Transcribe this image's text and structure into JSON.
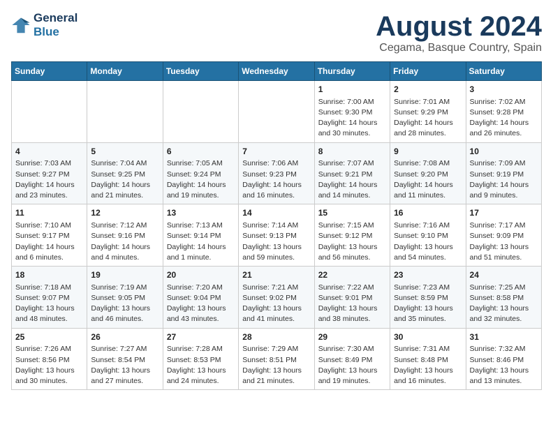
{
  "logo": {
    "line1": "General",
    "line2": "Blue"
  },
  "title": "August 2024",
  "location": "Cegama, Basque Country, Spain",
  "headers": [
    "Sunday",
    "Monday",
    "Tuesday",
    "Wednesday",
    "Thursday",
    "Friday",
    "Saturday"
  ],
  "weeks": [
    [
      {
        "day": "",
        "info": ""
      },
      {
        "day": "",
        "info": ""
      },
      {
        "day": "",
        "info": ""
      },
      {
        "day": "",
        "info": ""
      },
      {
        "day": "1",
        "info": "Sunrise: 7:00 AM\nSunset: 9:30 PM\nDaylight: 14 hours\nand 30 minutes."
      },
      {
        "day": "2",
        "info": "Sunrise: 7:01 AM\nSunset: 9:29 PM\nDaylight: 14 hours\nand 28 minutes."
      },
      {
        "day": "3",
        "info": "Sunrise: 7:02 AM\nSunset: 9:28 PM\nDaylight: 14 hours\nand 26 minutes."
      }
    ],
    [
      {
        "day": "4",
        "info": "Sunrise: 7:03 AM\nSunset: 9:27 PM\nDaylight: 14 hours\nand 23 minutes."
      },
      {
        "day": "5",
        "info": "Sunrise: 7:04 AM\nSunset: 9:25 PM\nDaylight: 14 hours\nand 21 minutes."
      },
      {
        "day": "6",
        "info": "Sunrise: 7:05 AM\nSunset: 9:24 PM\nDaylight: 14 hours\nand 19 minutes."
      },
      {
        "day": "7",
        "info": "Sunrise: 7:06 AM\nSunset: 9:23 PM\nDaylight: 14 hours\nand 16 minutes."
      },
      {
        "day": "8",
        "info": "Sunrise: 7:07 AM\nSunset: 9:21 PM\nDaylight: 14 hours\nand 14 minutes."
      },
      {
        "day": "9",
        "info": "Sunrise: 7:08 AM\nSunset: 9:20 PM\nDaylight: 14 hours\nand 11 minutes."
      },
      {
        "day": "10",
        "info": "Sunrise: 7:09 AM\nSunset: 9:19 PM\nDaylight: 14 hours\nand 9 minutes."
      }
    ],
    [
      {
        "day": "11",
        "info": "Sunrise: 7:10 AM\nSunset: 9:17 PM\nDaylight: 14 hours\nand 6 minutes."
      },
      {
        "day": "12",
        "info": "Sunrise: 7:12 AM\nSunset: 9:16 PM\nDaylight: 14 hours\nand 4 minutes."
      },
      {
        "day": "13",
        "info": "Sunrise: 7:13 AM\nSunset: 9:14 PM\nDaylight: 14 hours\nand 1 minute."
      },
      {
        "day": "14",
        "info": "Sunrise: 7:14 AM\nSunset: 9:13 PM\nDaylight: 13 hours\nand 59 minutes."
      },
      {
        "day": "15",
        "info": "Sunrise: 7:15 AM\nSunset: 9:12 PM\nDaylight: 13 hours\nand 56 minutes."
      },
      {
        "day": "16",
        "info": "Sunrise: 7:16 AM\nSunset: 9:10 PM\nDaylight: 13 hours\nand 54 minutes."
      },
      {
        "day": "17",
        "info": "Sunrise: 7:17 AM\nSunset: 9:09 PM\nDaylight: 13 hours\nand 51 minutes."
      }
    ],
    [
      {
        "day": "18",
        "info": "Sunrise: 7:18 AM\nSunset: 9:07 PM\nDaylight: 13 hours\nand 48 minutes."
      },
      {
        "day": "19",
        "info": "Sunrise: 7:19 AM\nSunset: 9:05 PM\nDaylight: 13 hours\nand 46 minutes."
      },
      {
        "day": "20",
        "info": "Sunrise: 7:20 AM\nSunset: 9:04 PM\nDaylight: 13 hours\nand 43 minutes."
      },
      {
        "day": "21",
        "info": "Sunrise: 7:21 AM\nSunset: 9:02 PM\nDaylight: 13 hours\nand 41 minutes."
      },
      {
        "day": "22",
        "info": "Sunrise: 7:22 AM\nSunset: 9:01 PM\nDaylight: 13 hours\nand 38 minutes."
      },
      {
        "day": "23",
        "info": "Sunrise: 7:23 AM\nSunset: 8:59 PM\nDaylight: 13 hours\nand 35 minutes."
      },
      {
        "day": "24",
        "info": "Sunrise: 7:25 AM\nSunset: 8:58 PM\nDaylight: 13 hours\nand 32 minutes."
      }
    ],
    [
      {
        "day": "25",
        "info": "Sunrise: 7:26 AM\nSunset: 8:56 PM\nDaylight: 13 hours\nand 30 minutes."
      },
      {
        "day": "26",
        "info": "Sunrise: 7:27 AM\nSunset: 8:54 PM\nDaylight: 13 hours\nand 27 minutes."
      },
      {
        "day": "27",
        "info": "Sunrise: 7:28 AM\nSunset: 8:53 PM\nDaylight: 13 hours\nand 24 minutes."
      },
      {
        "day": "28",
        "info": "Sunrise: 7:29 AM\nSunset: 8:51 PM\nDaylight: 13 hours\nand 21 minutes."
      },
      {
        "day": "29",
        "info": "Sunrise: 7:30 AM\nSunset: 8:49 PM\nDaylight: 13 hours\nand 19 minutes."
      },
      {
        "day": "30",
        "info": "Sunrise: 7:31 AM\nSunset: 8:48 PM\nDaylight: 13 hours\nand 16 minutes."
      },
      {
        "day": "31",
        "info": "Sunrise: 7:32 AM\nSunset: 8:46 PM\nDaylight: 13 hours\nand 13 minutes."
      }
    ]
  ]
}
